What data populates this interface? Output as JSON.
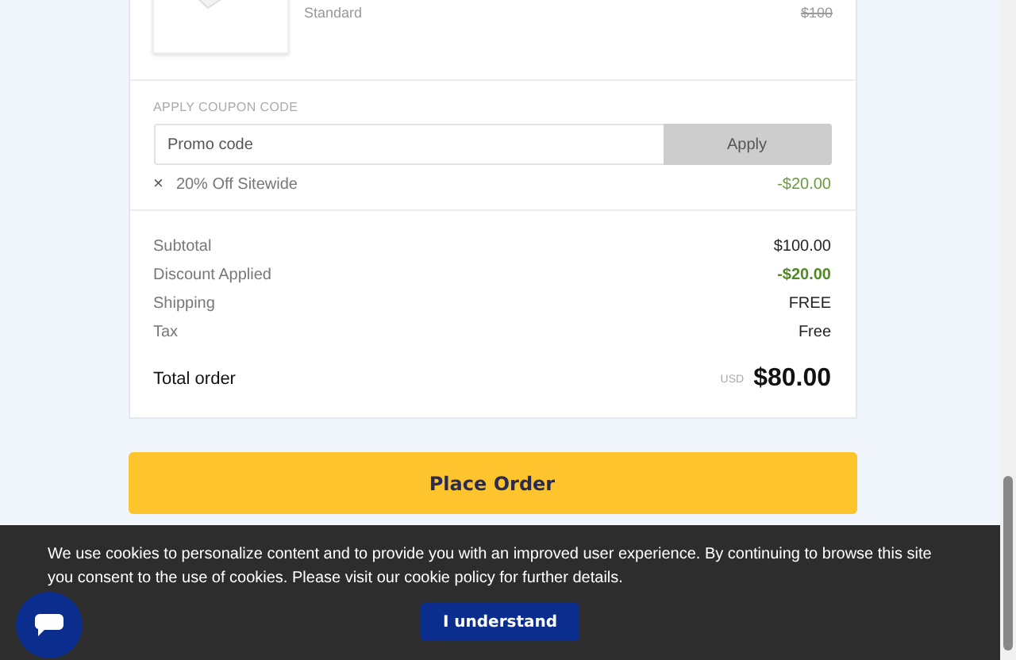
{
  "product": {
    "variant": "Standard",
    "original_price": "$100"
  },
  "coupon": {
    "label": "APPLY COUPON CODE",
    "placeholder": "Promo code",
    "button": "Apply",
    "applied": {
      "remove": "×",
      "name": "20% Off Sitewide",
      "amount": "-$20.00"
    }
  },
  "summary": {
    "rows": [
      {
        "label": "Subtotal",
        "value": "$100.00",
        "kind": "normal"
      },
      {
        "label": "Discount Applied",
        "value": "-$20.00",
        "kind": "discount"
      },
      {
        "label": "Shipping",
        "value": "FREE",
        "kind": "normal"
      },
      {
        "label": "Tax",
        "value": "Free",
        "kind": "normal"
      }
    ],
    "total": {
      "label": "Total order",
      "currency": "USD",
      "value": "$80.00"
    }
  },
  "place_order": "Place Order",
  "cookie_banner": {
    "text": "We use cookies to personalize content and to provide you with an improved user experience. By continuing to browse this site you consent to the use of cookies. Please visit our cookie policy for further details.",
    "button": "I understand"
  }
}
